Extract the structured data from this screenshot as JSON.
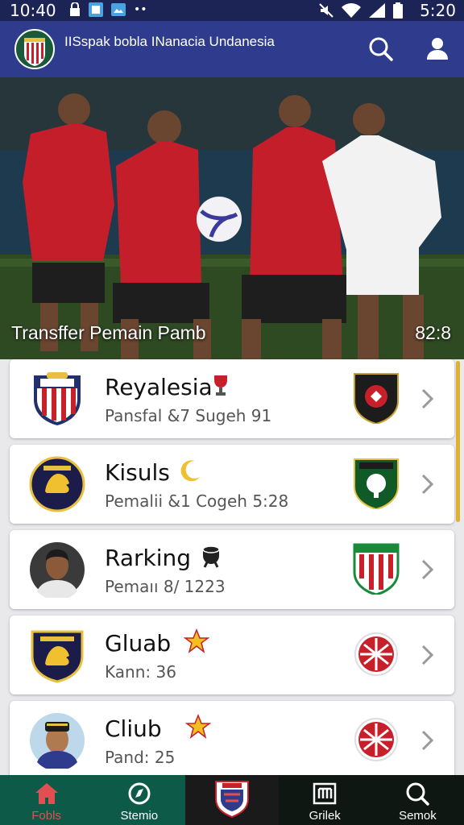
{
  "status_bar": {
    "time_left": "10:40",
    "time_right": "5:20",
    "dots": "••"
  },
  "app_bar": {
    "title": "IISspak bobla INanacia Undanesia"
  },
  "hero": {
    "title": "Transffer Pemain Pamb",
    "score": "82:8"
  },
  "cards": [
    {
      "name": "Reyalesia",
      "subtitle": "Pansfal &7 Sugeh 91",
      "left_icon": "shield-crest-icon",
      "name_icon": "trophy-icon",
      "right_icon": "club-badge-icon"
    },
    {
      "name": "Kisuls",
      "subtitle": "Pemalii &1 Cogeh 5:28",
      "left_icon": "lion-crest-icon",
      "name_icon": "crescent-icon",
      "right_icon": "tree-crest-icon"
    },
    {
      "name": "Rarking",
      "subtitle": "Pemaıı 8/ 1223",
      "left_icon": "player-avatar",
      "name_icon": "goal-icon",
      "right_icon": "striped-shield-icon"
    },
    {
      "name": "Gluab",
      "subtitle": "Kann: 36",
      "left_icon": "lion-crest-icon",
      "name_icon": "star-icon",
      "right_icon": "red-emblem-icon"
    },
    {
      "name": "Cliub",
      "subtitle": "Pand: 25",
      "left_icon": "player-avatar",
      "name_icon": "star-icon",
      "right_icon": "red-emblem-icon"
    }
  ],
  "bottom_nav": [
    {
      "label": "Fobls",
      "icon": "house-icon",
      "color": "#e05050"
    },
    {
      "label": "Stemio",
      "icon": "compass-icon",
      "color": "#ffffff"
    },
    {
      "label": "",
      "icon": "league-crest-icon",
      "color": "#ffffff"
    },
    {
      "label": "Grilek",
      "icon": "bracket-icon",
      "color": "#ffffff"
    },
    {
      "label": "Semok",
      "icon": "search-icon",
      "color": "#ffffff"
    }
  ],
  "colors": {
    "appbar": "#2f3c8e",
    "statusbar": "#1c2456",
    "nav_bg": "#0f1712",
    "nav_active_bg": "#0e5a48",
    "accent_red": "#c8202a"
  }
}
